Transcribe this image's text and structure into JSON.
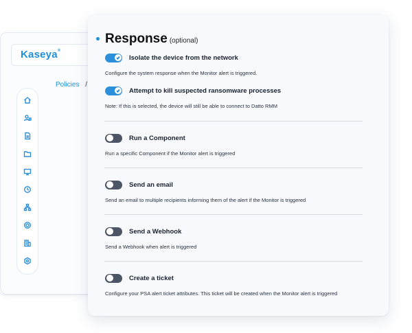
{
  "app": {
    "logo": "Kaseya",
    "logo_mark": "®"
  },
  "breadcrumb": {
    "policies": "Policies",
    "separator": "/"
  },
  "sidebar": {
    "icons": [
      "home-icon",
      "user-device-icon",
      "document-icon",
      "folder-icon",
      "desktop-icon",
      "clock-icon",
      "network-icon",
      "gear-cluster-icon",
      "building-icon",
      "settings-icon"
    ]
  },
  "response": {
    "title": "Response",
    "optional": "(optional)",
    "options": [
      {
        "label": "Isolate the device from the network",
        "description": "Configure the system response when the Monitor alert is triggered.",
        "enabled": true
      },
      {
        "label": "Attempt to kill suspected ransomware processes",
        "description": "Note: If this is selected, the device will still be able to connect to Datto RMM",
        "enabled": true
      },
      {
        "label": "Run a Component",
        "description": "Run a specific Component if the Monitor alert is triggered",
        "enabled": false
      },
      {
        "label": "Send an email",
        "description": "Send an email to multiple recipients informing them of the alert if the Monitor is triggered",
        "enabled": false
      },
      {
        "label": "Send a Webhook",
        "description": "Send a Webhook when alert is triggered",
        "enabled": false
      },
      {
        "label": "Create a ticket",
        "description": "Configure your PSA alert ticket attributes. This ticket will be created when the Monitor alert is triggered",
        "enabled": false
      }
    ]
  },
  "colors": {
    "accent": "#2b90d9",
    "toggle_off": "#4b5566"
  }
}
